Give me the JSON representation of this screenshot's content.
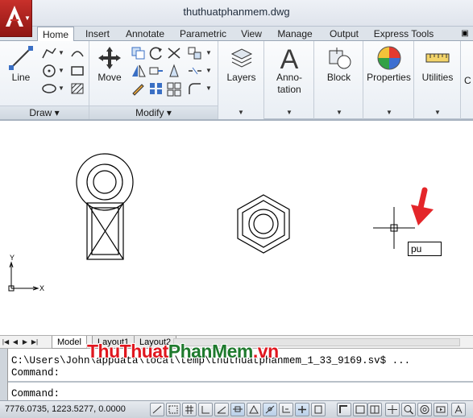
{
  "window": {
    "title": "thuthuatphanmem.dwg"
  },
  "tabs": [
    "Home",
    "Insert",
    "Annotate",
    "Parametric",
    "View",
    "Manage",
    "Output",
    "Express Tools"
  ],
  "active_tab": "Home",
  "ribbon": {
    "draw": {
      "label": "Draw",
      "line_label": "Line"
    },
    "modify": {
      "label": "Modify",
      "move_label": "Move"
    },
    "layers_label": "Layers",
    "annotation_label": "Anno-\ntation",
    "block_label": "Block",
    "properties_label": "Properties",
    "utilities_label": "Utilities",
    "clipboard_label": "C"
  },
  "canvas": {
    "input_value": "pu",
    "ucs_x": "X",
    "ucs_y": "Y"
  },
  "layout_tabs": [
    "Model",
    "Layout1",
    "Layout2"
  ],
  "command": {
    "line1": "C:\\Users\\John\\appdata\\local\\temp\\thuthuatphanmem_1_33_9169.sv$ ...",
    "line2": "Command:",
    "line3": "Command:"
  },
  "watermark": {
    "part1": "ThuThuat",
    "part2": "PhanMem",
    "part3": ".vn"
  },
  "status": {
    "coordinates": "7776.0735, 1223.5277, 0.0000"
  }
}
